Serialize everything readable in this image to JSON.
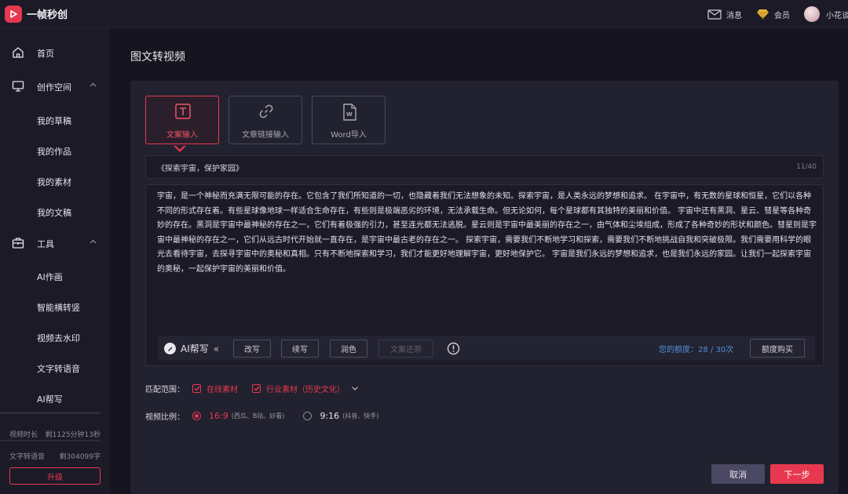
{
  "app": {
    "name": "一帧秒创"
  },
  "topbar": {
    "messages": "消息",
    "vip": "会员",
    "user": "小花谈"
  },
  "sidebar": {
    "home": "首页",
    "creation_space": "创作空间",
    "creation_items": [
      "我的草稿",
      "我的作品",
      "我的素材",
      "我的文稿"
    ],
    "tools": "工具",
    "tool_items": [
      "AI作画",
      "智能横转竖",
      "视频去水印",
      "文字转语音",
      "AI帮写"
    ],
    "usage": [
      {
        "label": "视频时长",
        "value": "剩1125分钟13秒"
      },
      {
        "label": "文字转语音",
        "value": "剩304099字"
      }
    ],
    "upgrade": "升级"
  },
  "page": {
    "title": "图文转视频"
  },
  "tabs": [
    {
      "label": "文案输入",
      "icon": "text-icon",
      "active": true
    },
    {
      "label": "文章链接输入",
      "icon": "link-icon",
      "active": false
    },
    {
      "label": "Word导入",
      "icon": "word-file-icon",
      "active": false
    }
  ],
  "title_input": {
    "value": "《探索宇宙，保护家园》",
    "count": "11/40"
  },
  "content": {
    "text": "宇宙，是一个神秘而充满无限可能的存在。它包含了我们所知道的一切，也隐藏着我们无法想象的未知。探索宇宙，是人类永远的梦想和追求。 在宇宙中，有无数的星球和恒星，它们以各种不同的形式存在着。有些星球像地球一样适合生命存在，有些则是极端恶劣的环境，无法承载生命。但无论如何，每个星球都有其独特的美丽和价值。 宇宙中还有黑洞、星云、彗星等各种奇妙的存在。黑洞是宇宙中最神秘的存在之一，它们有着极强的引力，甚至连光都无法逃脱。星云则是宇宙中最美丽的存在之一，由气体和尘埃组成，形成了各种奇妙的形状和颜色。彗星则是宇宙中最神秘的存在之一，它们从远古时代开始就一直存在，是宇宙中最古老的存在之一。 探索宇宙，需要我们不断地学习和探索，需要我们不断地挑战自我和突破极限。我们需要用科学的眼光去看待宇宙，去探寻宇宙中的奥秘和真相。只有不断地探索和学习，我们才能更好地理解宇宙，更好地保护它。 宇宙是我们永远的梦想和追求，也是我们永远的家园。让我们一起探索宇宙的奥秘，一起保护宇宙的美丽和价值。"
  },
  "ai": {
    "brand": "AI帮写",
    "collapse": "«",
    "rewrite": "改写",
    "continue": "续写",
    "polish": "润色",
    "restore": "文案还原",
    "quota": "您的额度：28 / 30次",
    "buy": "额度购买"
  },
  "match": {
    "label": "匹配范围：",
    "options": [
      "在线素材",
      "行业素材（历史文化）"
    ]
  },
  "ratio": {
    "label": "视频比例：",
    "options": [
      {
        "value": "16:9",
        "desc": "(西瓜、B站、好看)",
        "selected": true
      },
      {
        "value": "9:16",
        "desc": "(抖音、快手)",
        "selected": false
      }
    ]
  },
  "actions": {
    "cancel": "取消",
    "next": "下一步"
  },
  "colors": {
    "accent": "#e8384f",
    "link": "#4f8fdc",
    "background": "#15141f",
    "panel": "#22212f"
  }
}
